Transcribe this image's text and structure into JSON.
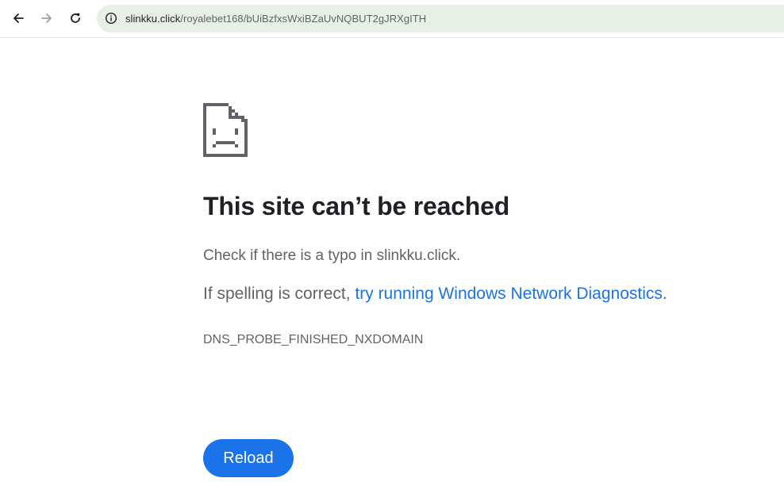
{
  "browser": {
    "back_icon": "arrow-left-icon",
    "forward_icon": "arrow-right-icon",
    "reload_icon": "refresh-icon",
    "site_info_icon": "info-circle-icon",
    "url_host": "slinkku.click",
    "url_path": "/royalebet168/bUiBzfxsWxiBZaUvNQBUT2gJRXgITH",
    "omnibox_color": "#e8efe6"
  },
  "error_page": {
    "icon": "sad-page-icon",
    "title": "This site can’t be reached",
    "message_check": "Check if there is a typo in slinkku.click.",
    "message_spelling_prefix": "If spelling is correct, ",
    "diagnostics_link": "try running Windows Network Diagnostics",
    "message_spelling_suffix": ".",
    "error_code": "DNS_PROBE_FINISHED_NXDOMAIN",
    "reload_label": "Reload",
    "accent_color": "#1a73e8"
  }
}
